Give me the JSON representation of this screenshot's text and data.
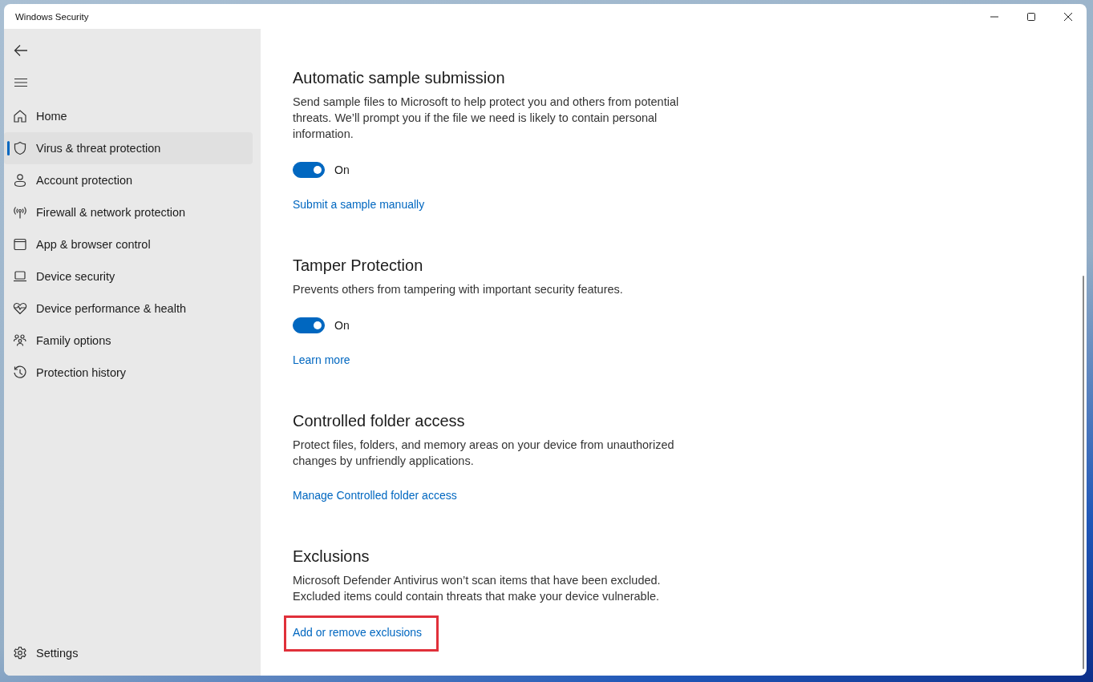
{
  "window": {
    "title": "Windows Security"
  },
  "sidebar": {
    "items": [
      {
        "label": "Home",
        "selected": false
      },
      {
        "label": "Virus & threat protection",
        "selected": true
      },
      {
        "label": "Account protection",
        "selected": false
      },
      {
        "label": "Firewall & network protection",
        "selected": false
      },
      {
        "label": "App & browser control",
        "selected": false
      },
      {
        "label": "Device security",
        "selected": false
      },
      {
        "label": "Device performance & health",
        "selected": false
      },
      {
        "label": "Family options",
        "selected": false
      },
      {
        "label": "Protection history",
        "selected": false
      }
    ],
    "settings": {
      "label": "Settings"
    }
  },
  "sections": [
    {
      "title": "Automatic sample submission",
      "description": "Send sample files to Microsoft to help protect you and others from potential threats. We’ll prompt you if the file we need is likely to contain personal information.",
      "toggle": {
        "on": true,
        "label": "On"
      },
      "link": {
        "label": "Submit a sample manually",
        "highlighted": false
      }
    },
    {
      "title": "Tamper Protection",
      "description": "Prevents others from tampering with important security features.",
      "toggle": {
        "on": true,
        "label": "On"
      },
      "link": {
        "label": "Learn more",
        "highlighted": false
      }
    },
    {
      "title": "Controlled folder access",
      "description": "Protect files, folders, and memory areas on your device from unauthorized changes by unfriendly applications.",
      "link": {
        "label": "Manage Controlled folder access",
        "highlighted": false
      }
    },
    {
      "title": "Exclusions",
      "description": "Microsoft Defender Antivirus won’t scan items that have been excluded. Excluded items could contain threats that make your device vulnerable.",
      "link": {
        "label": "Add or remove exclusions",
        "highlighted": true
      }
    }
  ]
}
